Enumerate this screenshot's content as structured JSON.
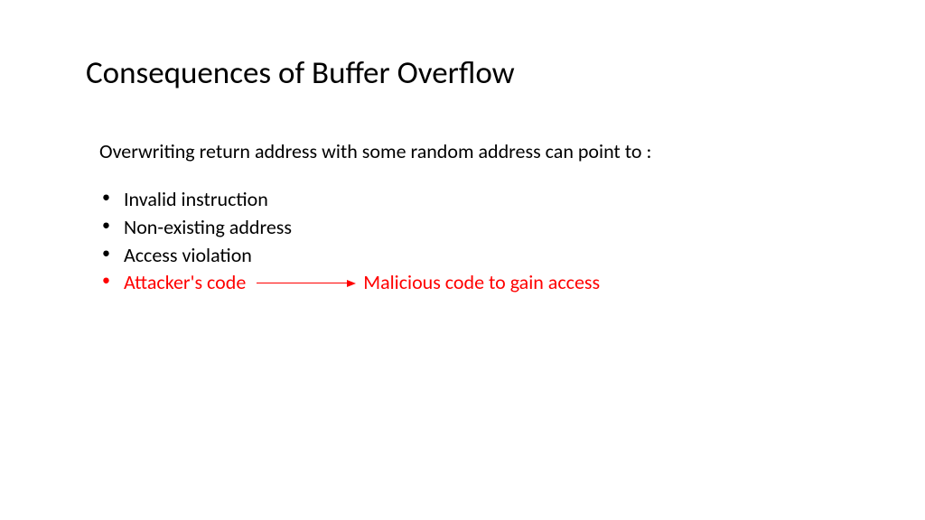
{
  "slide": {
    "title": "Consequences of Buffer Overflow",
    "intro": "Overwriting return address with some random address can point to :",
    "bullets": [
      {
        "text": "Invalid instruction",
        "highlight": false
      },
      {
        "text": "Non-existing address",
        "highlight": false
      },
      {
        "text": "Access violation",
        "highlight": false
      },
      {
        "text": "Attacker's code",
        "highlight": true
      }
    ],
    "arrow_target": "Malicious code to gain access"
  }
}
